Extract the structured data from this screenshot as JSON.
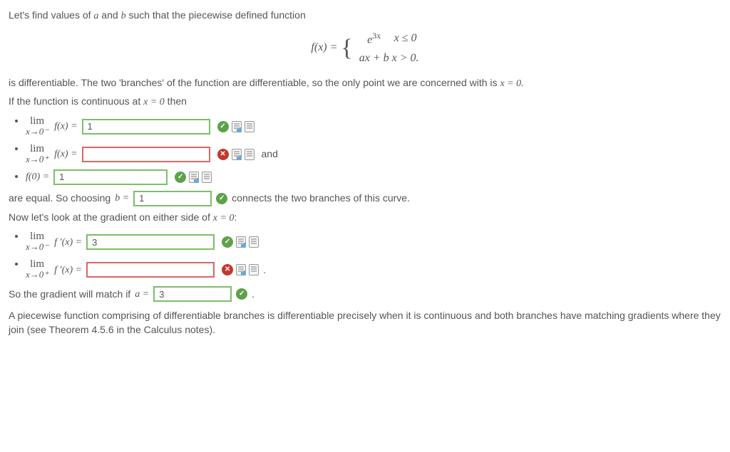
{
  "intro": {
    "line1_pre": "Let's find values of ",
    "a": "a",
    "line1_mid": " and ",
    "b": "b",
    "line1_post": " such that the piecewise defined function"
  },
  "piecewise": {
    "lhs": "f(x) = ",
    "r1_expr": "e",
    "r1_exp": "3x",
    "r1_cond": "x ≤ 0",
    "r2_expr": "ax + b",
    "r2_cond": "x > 0."
  },
  "line2": "is differentiable. The two 'branches' of the function are differentiable, so the only point we are concerned with is ",
  "line2_eq": "x = 0.",
  "line3_pre": "If the function is continuous at ",
  "line3_eq": "x = 0",
  "line3_post": " then",
  "limits1": {
    "item1": {
      "top": "lim",
      "bot": "x→0⁻",
      "fn": "f(x) =",
      "value": "1"
    },
    "item2": {
      "top": "lim",
      "bot": "x→0⁺",
      "fn": "f(x) =",
      "value": "",
      "tail": "and"
    },
    "item3": {
      "fn": "f(0) =",
      "value": "1"
    }
  },
  "equal_line": {
    "pre": "are equal. So choosing ",
    "lhs": "b = ",
    "value": "1",
    "post": " connects the two branches of this curve."
  },
  "grad_line": {
    "pre": "Now let's look at the gradient on either side of ",
    "eq": "x = 0",
    "post": ":"
  },
  "limits2": {
    "item1": {
      "top": "lim",
      "bot": "x→0⁻",
      "fn": "f ′(x) =",
      "value": "3"
    },
    "item2": {
      "top": "lim",
      "bot": "x→0⁺",
      "fn": "f ′(x) =",
      "value": "",
      "tail": "."
    }
  },
  "match_line": {
    "pre": "So the gradient will match if ",
    "lhs": "a = ",
    "value": "3",
    "post": "."
  },
  "footer": "A piecewise function comprising of differentiable branches is differentiable precisely when it is continuous and both branches have matching gradients where they join (see Theorem 4.5.6 in the Calculus notes)."
}
